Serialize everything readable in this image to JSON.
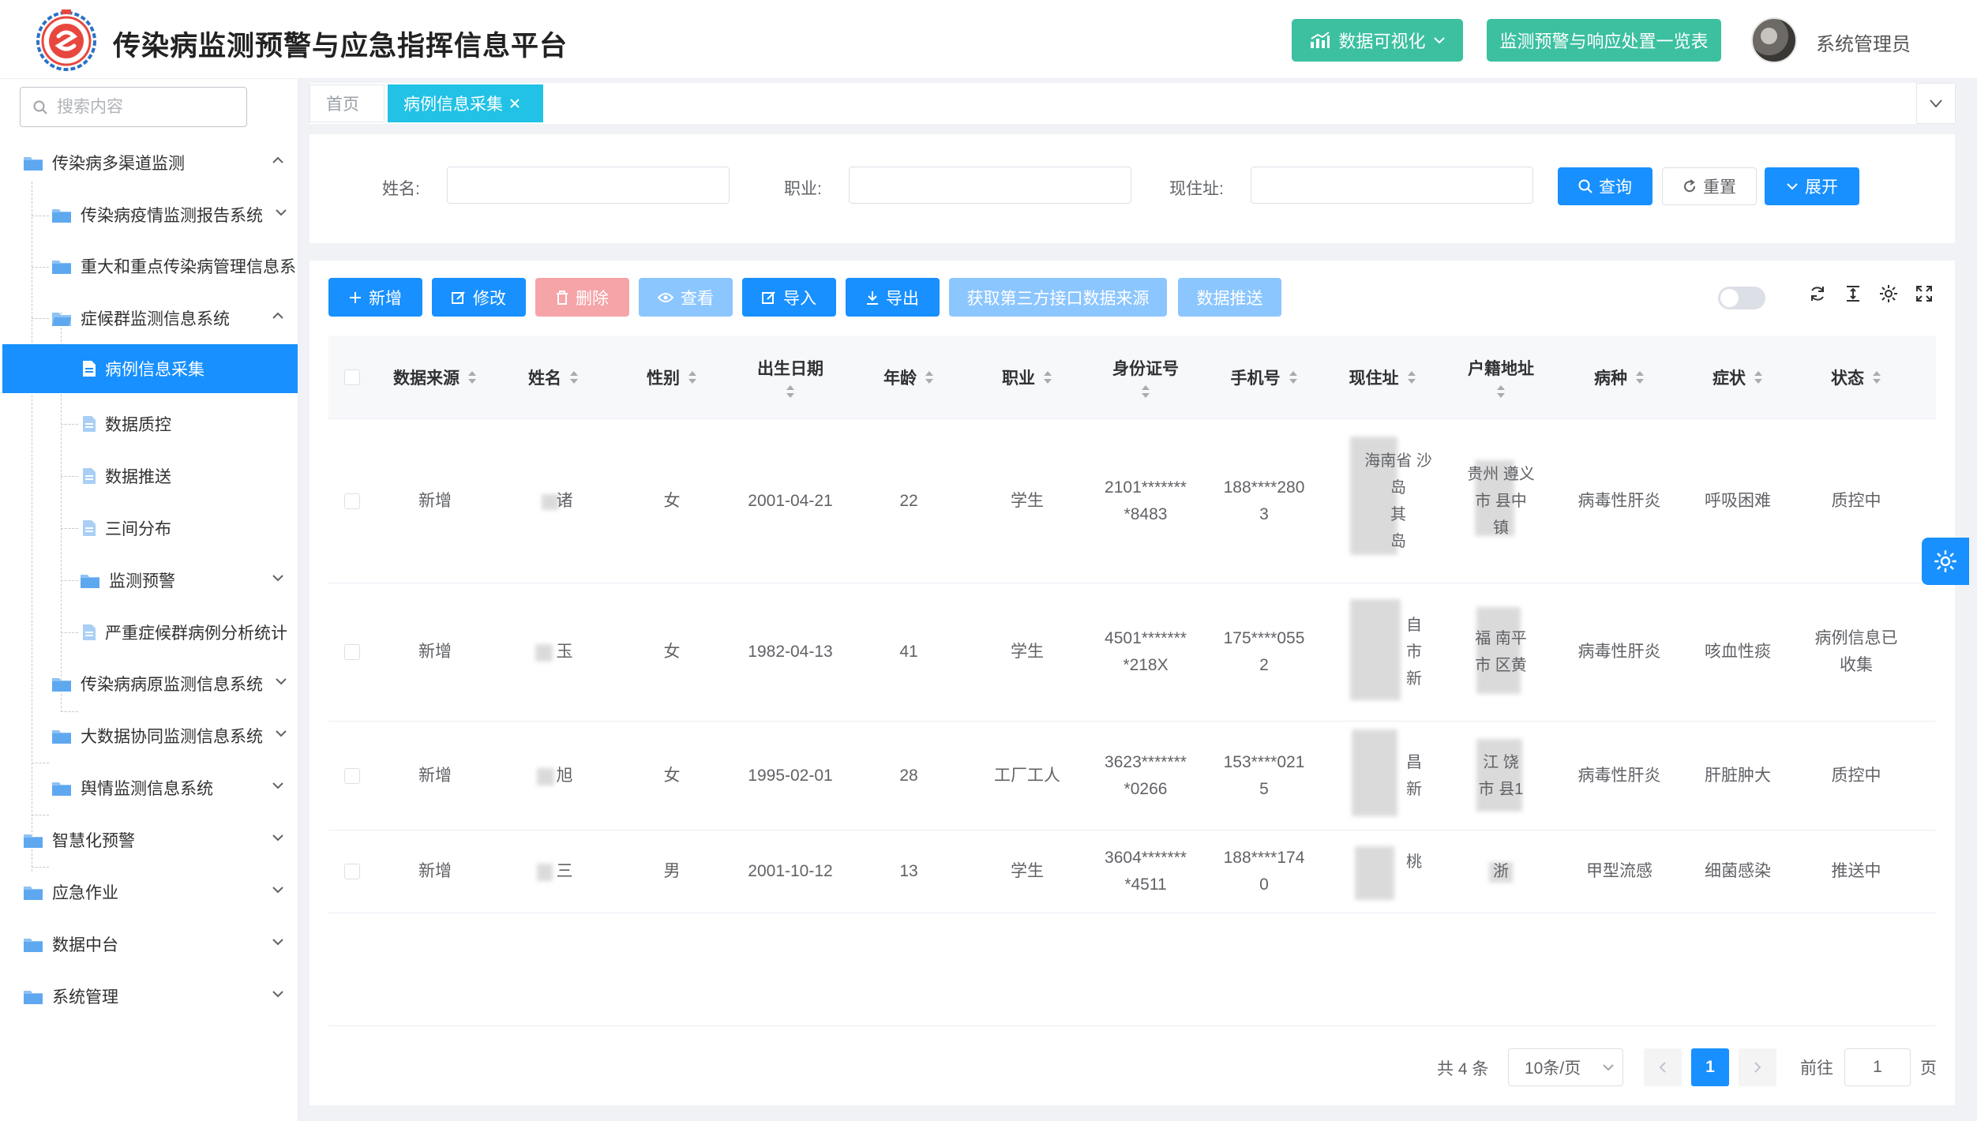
{
  "header": {
    "title": "传染病监测预警与应急指挥信息平台",
    "viz_button": "数据可视化",
    "alert_button": "监测预警与响应处置一览表",
    "username": "系统管理员"
  },
  "sidebar": {
    "search_placeholder": "搜索内容",
    "items": [
      {
        "label": "传染病多渠道监测"
      },
      {
        "label": "传染病疫情监测报告系统"
      },
      {
        "label": "重大和重点传染病管理信息系"
      },
      {
        "label": "症候群监测信息系统"
      },
      {
        "label": "病例信息采集"
      },
      {
        "label": "数据质控"
      },
      {
        "label": "数据推送"
      },
      {
        "label": "三间分布"
      },
      {
        "label": "监测预警"
      },
      {
        "label": "严重症候群病例分析统计"
      },
      {
        "label": "传染病病原监测信息系统"
      },
      {
        "label": "大数据协同监测信息系统"
      },
      {
        "label": "舆情监测信息系统"
      },
      {
        "label": "智慧化预警"
      },
      {
        "label": "应急作业"
      },
      {
        "label": "数据中台"
      },
      {
        "label": "系统管理"
      }
    ]
  },
  "tabs": {
    "home": "首页",
    "current": "病例信息采集"
  },
  "filter": {
    "name_label": "姓名:",
    "job_label": "职业:",
    "address_label": "现住址:",
    "query": "查询",
    "reset": "重置",
    "expand": "展开"
  },
  "toolbar": {
    "add": "新增",
    "edit": "修改",
    "delete": "删除",
    "view": "查看",
    "import": "导入",
    "export": "导出",
    "third_party": "获取第三方接口数据来源",
    "push": "数据推送"
  },
  "table": {
    "columns": [
      "数据来源",
      "姓名",
      "性别",
      "出生日期",
      "年龄",
      "职业",
      "身份证号",
      "手机号",
      "现住址",
      "户籍地址",
      "病种",
      "症状",
      "状态"
    ],
    "rows": [
      {
        "source": "新增",
        "name": "诸",
        "gender": "女",
        "birth": "2001-04-21",
        "age": "22",
        "job": "学生",
        "id": "2101*******\n*8483",
        "phone": "188****280\n3",
        "address": "海南省 沙\n岛\n其\n岛",
        "huji": "贵州 遵义\n市 县中\n镇",
        "disease": "病毒性肝炎",
        "symptom": "呼吸困难",
        "status": "质控中"
      },
      {
        "source": "新增",
        "name": "玉",
        "gender": "女",
        "birth": "1982-04-13",
        "age": "41",
        "job": "学生",
        "id": "4501*******\n*218X",
        "phone": "175****055\n2",
        "address": "自\n市\n新",
        "huji": "福 南平\n市 区黄",
        "disease": "病毒性肝炎",
        "symptom": "咳血性痰",
        "status": "病例信息已\n收集"
      },
      {
        "source": "新增",
        "name": "旭",
        "gender": "女",
        "birth": "1995-02-01",
        "age": "28",
        "job": "工厂工人",
        "id": "3623*******\n*0266",
        "phone": "153****021\n5",
        "address": "昌\n新",
        "huji": "江 饶\n市 县1",
        "disease": "病毒性肝炎",
        "symptom": "肝脏肿大",
        "status": "质控中"
      },
      {
        "source": "新增",
        "name": "三",
        "gender": "男",
        "birth": "2001-10-12",
        "age": "13",
        "job": "学生",
        "id": "3604*******\n*4511",
        "phone": "188****174\n0",
        "address": "桃",
        "huji": "浙",
        "disease": "甲型流感",
        "symptom": "细菌感染",
        "status": "推送中"
      }
    ]
  },
  "pagination": {
    "total": "共 4 条",
    "page_size": "10条/页",
    "current": "1",
    "goto_label": "前往",
    "goto_value": "1",
    "unit": "页"
  },
  "colors": {
    "primary": "#1890ff",
    "teal": "#3cc0a0",
    "tab_active": "#21c2e5",
    "danger_disabled": "#f5a4a8"
  }
}
